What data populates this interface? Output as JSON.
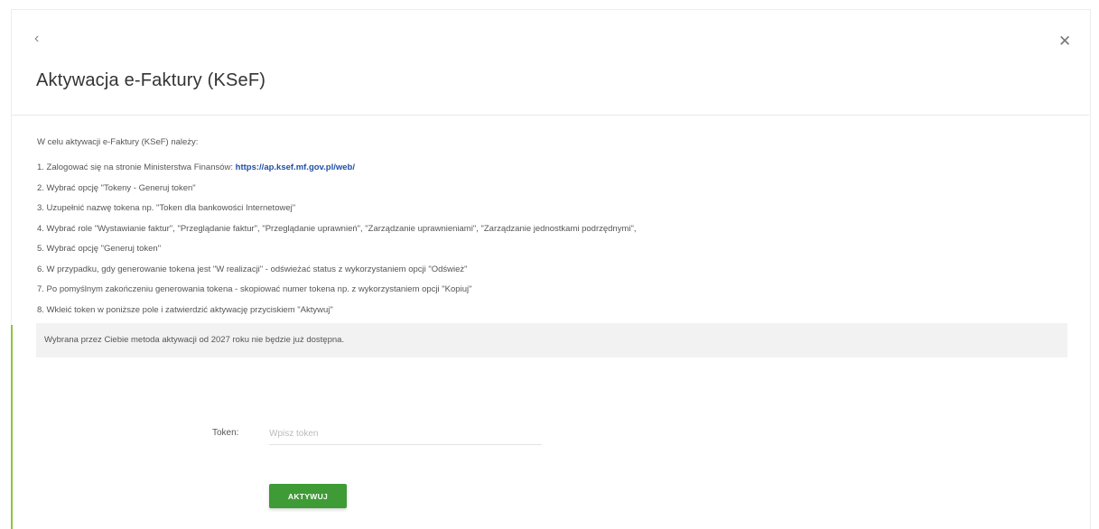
{
  "header": {
    "back_icon": "chevron-left-icon",
    "back_glyph": "‹",
    "close_icon": "close-icon",
    "close_glyph": "✕",
    "title": "Aktywacja e-Faktury (KSeF)"
  },
  "instructions": {
    "intro": "W celu aktywacji e-Faktury (KSeF) należy:",
    "steps": [
      {
        "text": "1. Zalogować się na stronie Ministerstwa Finansów: ",
        "link": "https://ap.ksef.mf.gov.pl/web/"
      },
      {
        "text": "2. Wybrać opcję \"Tokeny - Generuj token\""
      },
      {
        "text": "3. Uzupełnić nazwę tokena np. \"Token dla bankowości Internetowej\""
      },
      {
        "text": "4. Wybrać role \"Wystawianie faktur\", \"Przeglądanie faktur\", \"Przeglądanie uprawnień\", \"Zarządzanie uprawnieniami\", \"Zarządzanie jednostkami podrzędnymi\","
      },
      {
        "text": "5. Wybrać opcję \"Generuj token\""
      },
      {
        "text": "6. W przypadku, gdy generowanie tokena jest \"W realizacji\" - odświeżać status z wykorzystaniem opcji \"Odśwież\""
      },
      {
        "text": "7. Po pomyślnym zakończeniu generowania tokena - skopiować numer tokena np. z wykorzystaniem opcji \"Kopiuj\""
      },
      {
        "text": "8. Wkleić token w poniższe pole i zatwierdzić aktywację przyciskiem \"Aktywuj\""
      }
    ]
  },
  "notice": "Wybrana przez Ciebie metoda aktywacji od 2027 roku nie będzie już dostępna.",
  "form": {
    "token_label": "Token:",
    "token_value": "",
    "token_placeholder": "Wpisz token",
    "submit_label": "AKTYWUJ"
  },
  "colors": {
    "accent_green": "#3f9b35",
    "link_blue": "#1f4fa8",
    "edge_green": "#8cc63f"
  }
}
